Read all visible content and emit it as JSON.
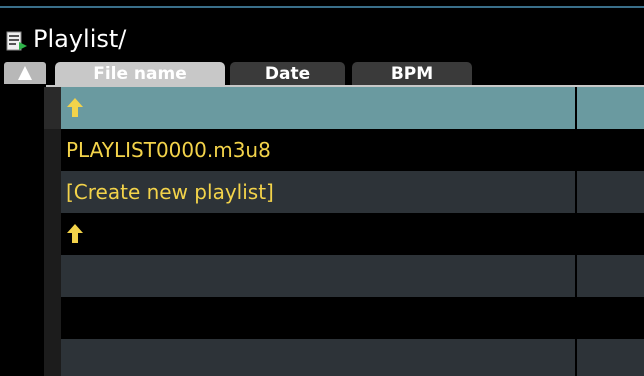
{
  "window": {
    "title": "Playlist/"
  },
  "tabs": [
    {
      "label": "File name",
      "active": true
    },
    {
      "label": "Date",
      "active": false
    },
    {
      "label": "BPM",
      "active": false
    }
  ],
  "sort_button": {
    "icon": "triangle-up-icon"
  },
  "rows": [
    {
      "type": "up",
      "icon": "up-arrow-icon",
      "label": "",
      "selected": true
    },
    {
      "type": "file",
      "label": "PLAYLIST0000.m3u8"
    },
    {
      "type": "action",
      "label": "[Create new playlist]"
    },
    {
      "type": "up",
      "icon": "up-arrow-icon",
      "label": ""
    },
    {
      "type": "empty",
      "label": ""
    },
    {
      "type": "empty",
      "label": ""
    },
    {
      "type": "empty",
      "label": ""
    }
  ],
  "colors": {
    "selected_row": "#6a9aa0",
    "alt_row": "#2d3338",
    "file_text": "#f3d34a",
    "active_tab": "#c8c8c8",
    "inactive_tab": "#3a3a3a"
  }
}
